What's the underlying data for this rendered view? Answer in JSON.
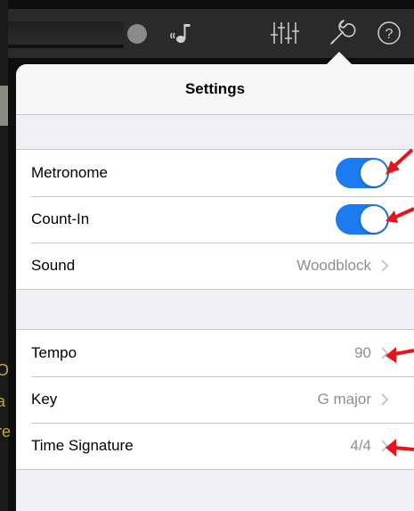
{
  "popover": {
    "title": "Settings",
    "group1": [
      {
        "label": "Metronome",
        "type": "toggle",
        "on": true
      },
      {
        "label": "Count-In",
        "type": "toggle",
        "on": true
      },
      {
        "label": "Sound",
        "type": "value",
        "value": "Woodblock"
      }
    ],
    "group2": [
      {
        "label": "Tempo",
        "type": "value",
        "value": "90"
      },
      {
        "label": "Key",
        "type": "value",
        "value": "G major"
      },
      {
        "label": "Time Signature",
        "type": "value",
        "value": "4/4"
      }
    ]
  },
  "toolbar": {
    "icons": [
      "record-icon",
      "metronome-icon",
      "mixer-icon",
      "wrench-icon",
      "help-icon"
    ],
    "help_glyph": "?"
  },
  "background": {
    "partial_letters": [
      "O",
      "a",
      "re"
    ]
  },
  "colors": {
    "toggle_on": "#1a7cf0",
    "annotation_arrow": "#e8141c",
    "value_text": "#8e8e93"
  }
}
